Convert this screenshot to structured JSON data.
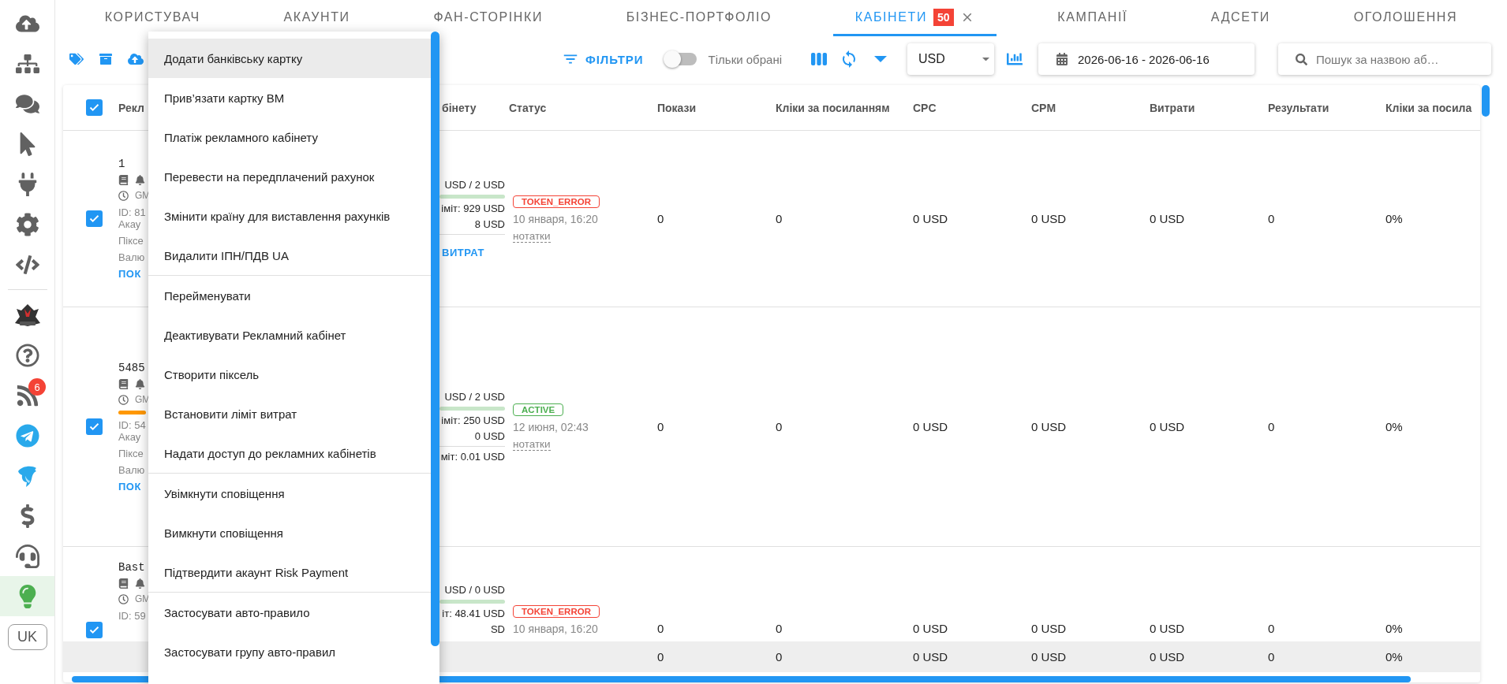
{
  "sidebar": {
    "items": [
      {
        "selected": false
      },
      {
        "selected": false
      },
      {
        "selected": false
      },
      {
        "selected": false
      },
      {
        "selected": false
      },
      {
        "selected": false
      },
      {
        "selected": false
      },
      {
        "selected": false
      },
      {
        "selected": false
      },
      {
        "selected": false,
        "badge": "6"
      },
      {
        "selected": false
      },
      {
        "selected": false
      },
      {
        "selected": false
      },
      {
        "selected": false
      },
      {
        "selected": true
      }
    ],
    "language": "UK"
  },
  "tabs": [
    {
      "label": "КОРИСТУВАЧ",
      "selected": false
    },
    {
      "label": "АКАУНТИ",
      "selected": false
    },
    {
      "label": "ФАН-СТОРІНКИ",
      "selected": false
    },
    {
      "label": "БІЗНЕС-ПОРТФОЛІО",
      "selected": false
    },
    {
      "label": "КАБІНЕТИ",
      "selected": true,
      "badge": "50",
      "closable": true
    },
    {
      "label": "КАМПАНІЇ",
      "selected": false
    },
    {
      "label": "АДСЕТИ",
      "selected": false
    },
    {
      "label": "ОГОЛОШЕННЯ",
      "selected": false
    }
  ],
  "toolbar": {
    "filters": "ФІЛЬТРИ",
    "only_selected": {
      "label": "Тільки обрані",
      "on": false
    },
    "currency": "USD",
    "date_range": "2026-06-16 - 2026-06-16",
    "search": {
      "placeholder": "Пошук за назвою аб…"
    }
  },
  "table": {
    "header_checked": true,
    "columns": [
      "Рекл",
      "бінету",
      "Статус",
      "Покази",
      "Кліки за посиланням",
      "CPC",
      "CPM",
      "Витрати",
      "Результати",
      "Кліки за посила"
    ],
    "rows": [
      {
        "checked": true,
        "name": "1",
        "timezone": "GM",
        "id": "ID: 81",
        "account": "Акау",
        "pixel": "Піксе",
        "currency": "Валю",
        "link": "ПОК",
        "budget": {
          "spend": "USD / 2 USD",
          "limit": "іміт: 929 USD",
          "balance": "8 USD",
          "link": "ВИТРАТ"
        },
        "status": {
          "text": "TOKEN_ERROR",
          "kind": "error"
        },
        "date": "10 января, 16:20",
        "notes": "нотатки",
        "metrics": [
          "0",
          "0",
          "0 USD",
          "0 USD",
          "0 USD",
          "0",
          "0%"
        ]
      },
      {
        "checked": true,
        "name": "5485",
        "timezone": "GM",
        "id": "ID: 54",
        "account": "Акау",
        "pixel": "Піксе",
        "currency": "Валю",
        "link": "ПОК",
        "alert_bar": true,
        "budget": {
          "spend": "USD / 2 USD",
          "limit": "іміт: 250 USD",
          "balance": "0 USD",
          "second_limit": "міт: 0.01 USD"
        },
        "status": {
          "text": "ACTIVE",
          "kind": "active"
        },
        "date": "12 июня, 02:43",
        "notes": "нотатки",
        "metrics": [
          "0",
          "0",
          "0 USD",
          "0 USD",
          "0 USD",
          "0",
          "0%"
        ]
      },
      {
        "checked": true,
        "name": "Bast",
        "timezone": "GM",
        "id": "ID: 59",
        "budget": {
          "spend": "USD / 0 USD",
          "limit": "іт: 48.41 USD",
          "balance": "SD"
        },
        "status": {
          "text": "TOKEN_ERROR",
          "kind": "error"
        },
        "date": "10 января, 16:20",
        "metrics": [
          "0",
          "0",
          "0 USD",
          "0 USD",
          "0 USD",
          "0",
          "0%"
        ]
      }
    ],
    "totals": [
      "0",
      "0",
      "0 USD",
      "0 USD",
      "0 USD",
      "0",
      "0%"
    ]
  },
  "menu": {
    "groups": [
      [
        {
          "label": "Додати банківську картку",
          "selected": true
        },
        {
          "label": "Прив’язати картку BM",
          "selected": false
        },
        {
          "label": "Платіж рекламного кабінету",
          "selected": false
        },
        {
          "label": "Перевести на передплачений рахунок",
          "selected": false
        },
        {
          "label": "Змінити країну для виставлення рахунків",
          "selected": false
        },
        {
          "label": "Видалити ІПН/ПДВ UA",
          "selected": false
        }
      ],
      [
        {
          "label": "Перейменувати",
          "selected": false
        },
        {
          "label": "Деактивувати Рекламний кабінет",
          "selected": false
        },
        {
          "label": "Створити піксель",
          "selected": false
        },
        {
          "label": "Встановити ліміт витрат",
          "selected": false
        },
        {
          "label": "Надати доступ до рекламних кабінетів",
          "selected": false
        }
      ],
      [
        {
          "label": "Увімкнути сповіщення",
          "selected": false
        },
        {
          "label": "Вимкнути сповіщення",
          "selected": false
        },
        {
          "label": "Підтвердити акаунт Risk Payment",
          "selected": false
        }
      ],
      [
        {
          "label": "Застосувати авто-правило",
          "selected": false
        },
        {
          "label": "Застосувати групу авто-правил",
          "selected": false
        }
      ]
    ]
  }
}
